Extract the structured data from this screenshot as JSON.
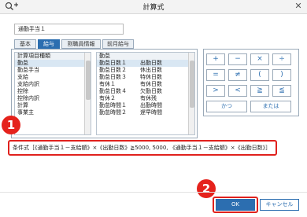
{
  "window": {
    "title": "計算式",
    "close_glyph": "✕"
  },
  "name_field": {
    "value": "通勤手当１"
  },
  "tabs": [
    {
      "label": "基本",
      "active": false
    },
    {
      "label": "給与",
      "active": true
    },
    {
      "label": "割職員情報",
      "active": false
    },
    {
      "label": "前月給与",
      "active": false
    }
  ],
  "list_left": {
    "header": "計算項目種類",
    "items": [
      "勤怠",
      "勤怠手当",
      "支給",
      "支給内訳",
      "控除",
      "控除内訳",
      "計算",
      "事業主"
    ],
    "selected_index": 0
  },
  "list_right": {
    "header": "勤怠",
    "items": [
      [
        "勤怠日数１",
        "出勤日数"
      ],
      [
        "勤怠日数２",
        "休出日数"
      ],
      [
        "勤怠日数３",
        "特休日数"
      ],
      [
        "有休１",
        "有休日数"
      ],
      [
        "勤怠日数４",
        "欠勤日数"
      ],
      [
        "有休２",
        "有休残"
      ],
      [
        "勤怠時間１",
        "出勤時間"
      ],
      [
        "勤怠時間２",
        "遅早時間"
      ]
    ],
    "selected_index": 0
  },
  "operators": {
    "row1": [
      "+",
      "−",
      "×",
      "÷"
    ],
    "row2": [
      "=",
      "≠",
      "(",
      ")"
    ],
    "row3": [
      ">",
      "<",
      "≧",
      "≦"
    ],
    "logic": [
      "かつ",
      "または"
    ]
  },
  "formula": {
    "text": "条件式［《通勤手当１－支給額》×《出勤日数》≧5000, 5000, 《通勤手当１－支給額》×《出勤日数》］"
  },
  "badges": [
    "1",
    "2"
  ],
  "buttons": {
    "ok": "OK",
    "cancel": "キャンセル"
  },
  "colors": {
    "accent": "#2c6eb0",
    "highlight": "#e0211d"
  },
  "icons": {
    "title": "search-plus-icon",
    "close": "close-icon"
  }
}
